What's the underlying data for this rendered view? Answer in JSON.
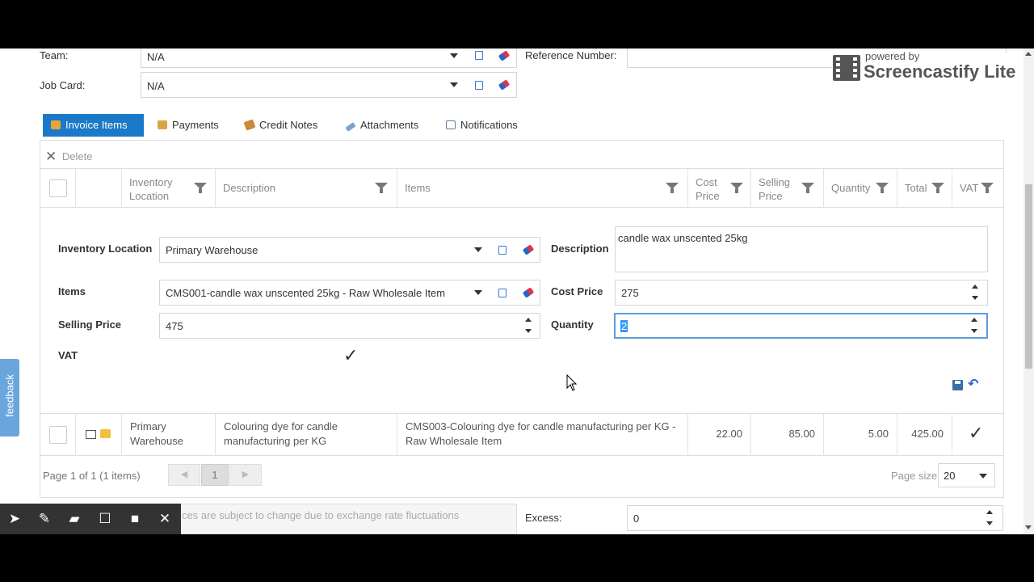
{
  "header": {
    "team_label": "Team:",
    "team_value": "N/A",
    "jobcard_label": "Job Card:",
    "jobcard_value": "N/A",
    "reference_label": "Reference Number:",
    "reference_value": ""
  },
  "watermark": {
    "powered_by": "powered by",
    "brand": "Screencastify Lite"
  },
  "tabs": [
    {
      "label": "Invoice Items",
      "icon": "box-icon",
      "active": true
    },
    {
      "label": "Payments",
      "icon": "payments-icon",
      "active": false
    },
    {
      "label": "Credit Notes",
      "icon": "credit-note-icon",
      "active": false
    },
    {
      "label": "Attachments",
      "icon": "paperclip-icon",
      "active": false
    },
    {
      "label": "Notifications",
      "icon": "notification-icon",
      "active": false
    }
  ],
  "grid": {
    "delete_label": "Delete",
    "columns": [
      {
        "label": "Inventory Location"
      },
      {
        "label": "Description"
      },
      {
        "label": "Items"
      },
      {
        "label": "Cost Price"
      },
      {
        "label": "Selling Price"
      },
      {
        "label": "Quantity"
      },
      {
        "label": "Total"
      },
      {
        "label": "VAT"
      }
    ],
    "rows": [
      {
        "inventory_location": "Primary Warehouse",
        "description": "Colouring dye for candle manufacturing per KG",
        "items": "CMS003-Colouring dye for candle manufacturing per KG - Raw Wholesale Item",
        "cost_price": "22.00",
        "selling_price": "85.00",
        "quantity": "5.00",
        "total": "425.00",
        "vat": true
      }
    ]
  },
  "editor": {
    "inventory_location_label": "Inventory Location",
    "inventory_location_value": "Primary Warehouse",
    "items_label": "Items",
    "items_value": "CMS001-candle wax unscented 25kg - Raw Wholesale Item",
    "selling_price_label": "Selling Price",
    "selling_price_value": "475",
    "vat_label": "VAT",
    "vat_checked": true,
    "description_label": "Description",
    "description_value": "candle wax unscented 25kg",
    "cost_price_label": "Cost Price",
    "cost_price_value": "275",
    "quantity_label": "Quantity",
    "quantity_value": "2"
  },
  "pager": {
    "info": "Page 1 of 1 (1 items)",
    "current_page": "1",
    "page_size_label": "Page size:",
    "page_size_value": "20"
  },
  "footer": {
    "note": "ces are subject to change due to exchange rate fluctuations",
    "excess_label": "Excess:",
    "excess_value": "0"
  },
  "feedback_tab": "feedback",
  "colors": {
    "accent": "#1a7ac8",
    "selection": "#3399ff",
    "toolbar": "#333333"
  }
}
